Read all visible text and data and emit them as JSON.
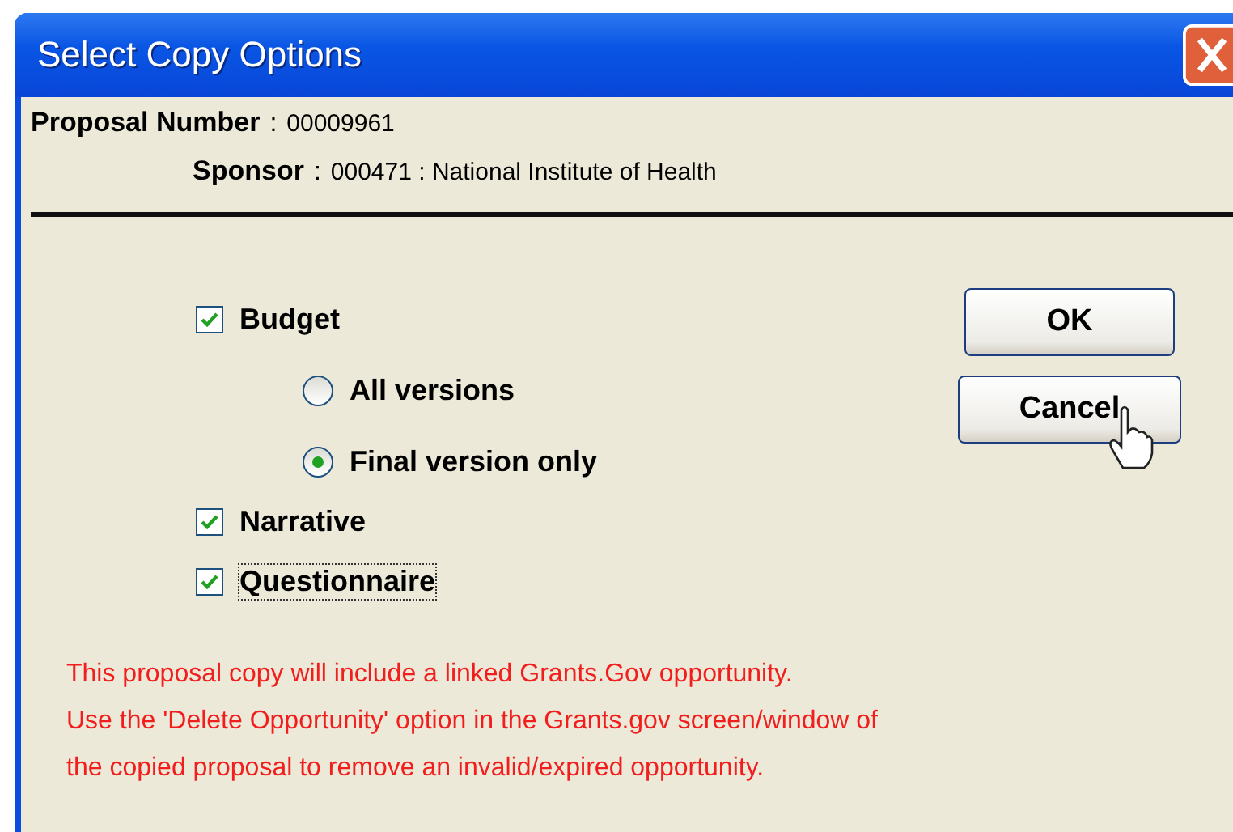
{
  "window": {
    "title": "Select Copy Options"
  },
  "header": [
    {
      "label": "Proposal Number",
      "separator": ":",
      "value": "00009961"
    },
    {
      "label": "Sponsor",
      "separator": ":",
      "value": "000471 : National Institute of Health"
    }
  ],
  "options": [
    {
      "kind": "checkbox",
      "label": "Budget",
      "checked": true,
      "focused": false,
      "children": [
        {
          "kind": "radio",
          "label": "All versions",
          "selected": false
        },
        {
          "kind": "radio",
          "label": "Final version only",
          "selected": true
        }
      ]
    },
    {
      "kind": "checkbox",
      "label": "Narrative",
      "checked": true,
      "focused": false
    },
    {
      "kind": "checkbox",
      "label": "Questionnaire",
      "checked": true,
      "focused": true
    }
  ],
  "buttons": [
    {
      "label": "OK"
    },
    {
      "label": "Cancel"
    }
  ],
  "message": [
    "This proposal copy will include a linked Grants.Gov opportunity.",
    "Use the 'Delete Opportunity' option in the Grants.gov screen/window of",
    "the copied proposal to remove an invalid/expired opportunity."
  ]
}
